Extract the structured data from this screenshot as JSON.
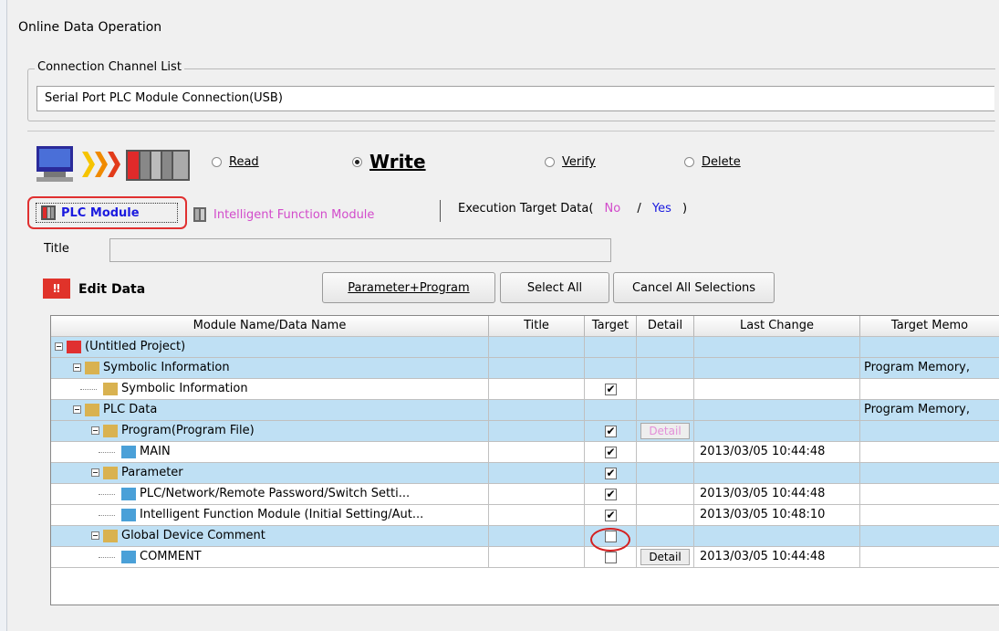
{
  "window": {
    "title": "Online Data Operation"
  },
  "connection": {
    "group_label": "Connection Channel List",
    "channel": "Serial Port  PLC Module Connection(USB)"
  },
  "operations": {
    "read": "Read",
    "write": "Write",
    "verify": "Verify",
    "delete": "Delete",
    "selected": "write"
  },
  "tabs": {
    "plc_module": "PLC Module",
    "intelligent": "Intelligent Function Module",
    "exec_prefix": "Execution Target Data(",
    "exec_no": "No",
    "exec_slash": "/",
    "exec_yes": "Yes",
    "exec_suffix": ")"
  },
  "title_field": {
    "label": "Title",
    "value": ""
  },
  "edit": {
    "label": "Edit Data",
    "icon_text": "‼",
    "param_program": "Parameter+Program",
    "select_all": "Select All",
    "cancel_all": "Cancel All Selections"
  },
  "table": {
    "headers": [
      "Module Name/Data Name",
      "Title",
      "Target",
      "Detail",
      "Last Change",
      "Target Memo"
    ],
    "rows": [
      {
        "name": "(Untitled Project)",
        "level": 0,
        "target": "",
        "detail": "",
        "last": "",
        "mem": ""
      },
      {
        "name": "Symbolic Information",
        "level": 1,
        "target": "",
        "detail": "",
        "last": "",
        "mem": "Program Memory,"
      },
      {
        "name": "Symbolic Information",
        "level": 2,
        "target": "✔",
        "detail": "",
        "last": "",
        "mem": ""
      },
      {
        "name": "PLC Data",
        "level": 1,
        "target": "",
        "detail": "",
        "last": "",
        "mem": "Program Memory,"
      },
      {
        "name": "Program(Program File)",
        "level": 2,
        "target": "✔",
        "detail": "Detail",
        "last": "",
        "mem": ""
      },
      {
        "name": "MAIN",
        "level": 3,
        "target": "✔",
        "detail": "",
        "last": "2013/03/05 10:44:48",
        "mem": ""
      },
      {
        "name": "Parameter",
        "level": 2,
        "target": "✔",
        "detail": "",
        "last": "",
        "mem": ""
      },
      {
        "name": "PLC/Network/Remote Password/Switch Setti...",
        "level": 3,
        "target": "✔",
        "detail": "",
        "last": "2013/03/05 10:44:48",
        "mem": ""
      },
      {
        "name": "Intelligent Function Module (Initial Setting/Aut...",
        "level": 3,
        "target": "✔",
        "detail": "",
        "last": "2013/03/05 10:48:10",
        "mem": ""
      },
      {
        "name": "Global Device Comment",
        "level": 2,
        "target": "",
        "detail": "",
        "last": "",
        "mem": ""
      },
      {
        "name": "COMMENT",
        "level": 3,
        "target": "",
        "detail": "Detail",
        "last": "2013/03/05 10:44:48",
        "mem": ""
      }
    ]
  },
  "colors": {
    "row_blue": "#bfe0f4",
    "accent_red": "#e03030",
    "plc_blue": "#1a1adf",
    "pink": "#d24bcb"
  }
}
